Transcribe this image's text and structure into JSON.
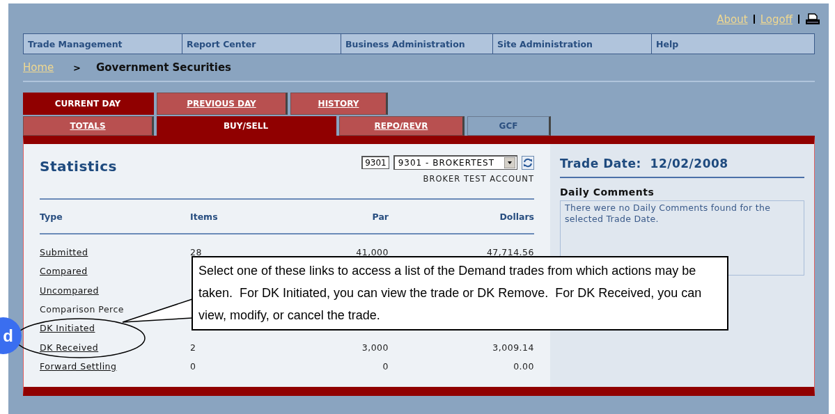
{
  "top_links": [
    {
      "label": "About"
    },
    {
      "label": "Logoff"
    }
  ],
  "nav": [
    {
      "label": "Trade Management"
    },
    {
      "label": "Report Center"
    },
    {
      "label": "Business Administration"
    },
    {
      "label": "Site Administration"
    },
    {
      "label": "Help"
    }
  ],
  "breadcrumb": {
    "home": "Home",
    "separator": ">",
    "current": "Government Securities"
  },
  "tabs_row_1": [
    {
      "label": "CURRENT DAY",
      "selected": true,
      "disabled": false
    },
    {
      "label": "PREVIOUS DAY",
      "selected": false,
      "disabled": false
    },
    {
      "label": "HISTORY",
      "selected": false,
      "disabled": false
    }
  ],
  "tabs_row_2": [
    {
      "label": "TOTALS",
      "selected": false,
      "disabled": false
    },
    {
      "label": "BUY/SELL",
      "selected": true,
      "disabled": false
    },
    {
      "label": "REPO/REVR",
      "selected": false,
      "disabled": false
    },
    {
      "label": "GCF",
      "selected": false,
      "disabled": true
    }
  ],
  "statistics": {
    "title": "Statistics",
    "account_code": "9301",
    "account_select": "9301 - BROKERTEST",
    "account_name": "BROKER TEST ACCOUNT",
    "columns": [
      "Type",
      "Items",
      "Par",
      "Dollars"
    ],
    "rows": [
      {
        "kind": "link",
        "type": "Submitted",
        "items": "28",
        "par": "41,000",
        "dollars": "47,714.56"
      },
      {
        "kind": "link",
        "type": "Compared",
        "items": "",
        "par": "",
        "dollars": ""
      },
      {
        "kind": "link",
        "type": "Uncompared",
        "items": "",
        "par": "",
        "dollars": ""
      },
      {
        "kind": "text",
        "type": "Comparison Perce",
        "items": "",
        "par": "",
        "dollars": ""
      },
      {
        "kind": "link",
        "type": "DK Initiated",
        "items": "",
        "par": "",
        "dollars": ""
      },
      {
        "kind": "link",
        "type": "DK Received",
        "items": "2",
        "par": "3,000",
        "dollars": "3,009.14"
      },
      {
        "kind": "link",
        "type": "Forward Settling",
        "items": "0",
        "par": "0",
        "dollars": "0.00"
      }
    ]
  },
  "trade_date": {
    "label": "Trade Date:",
    "value": "12/02/2008"
  },
  "daily_comments": {
    "title": "Daily Comments",
    "text": "There were no Daily Comments found for the selected Trade Date."
  },
  "callout": {
    "text": "Select one of these links to access a list of the Demand trades from which actions may be taken.  For DK Initiated, you can view the trade or DK Remove.  For DK Received, you can view, modify, or cancel the trade."
  },
  "step_badge": {
    "label": "d"
  }
}
